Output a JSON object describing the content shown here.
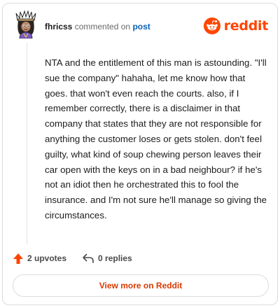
{
  "comment": {
    "username": "fhricss",
    "action_text": "commented on",
    "post_link": "post",
    "body": "NTA and the entitlement of this man is astounding. \"I'll sue the company\" hahaha, let me know how that goes. that won't even reach the courts. also, if I remember correctly, there is a disclaimer in that company that states that they are not responsible for anything the customer loses or gets stolen. don't feel guilty, what kind of soup chewing person leaves their car open with the keys on in a bad neighbour? if he's not an idiot then he orchestrated this to fool the insurance. and I'm not sure he'll manage so giving the circumstances."
  },
  "brand": {
    "wordmark": "reddit",
    "icon": "reddit-snoo-icon",
    "color": "#ff4500"
  },
  "footer": {
    "upvotes_label": "2 upvotes",
    "replies_label": "0 replies",
    "upvote_icon": "upvote-arrow-icon",
    "reply_icon": "reply-arrow-icon",
    "upvote_color": "#ff4500"
  },
  "cta": {
    "label": "View more on Reddit",
    "color": "#d93900"
  },
  "colors": {
    "link": "#0a61b5",
    "muted": "#6a6a6a",
    "border": "#dcdcdc"
  }
}
